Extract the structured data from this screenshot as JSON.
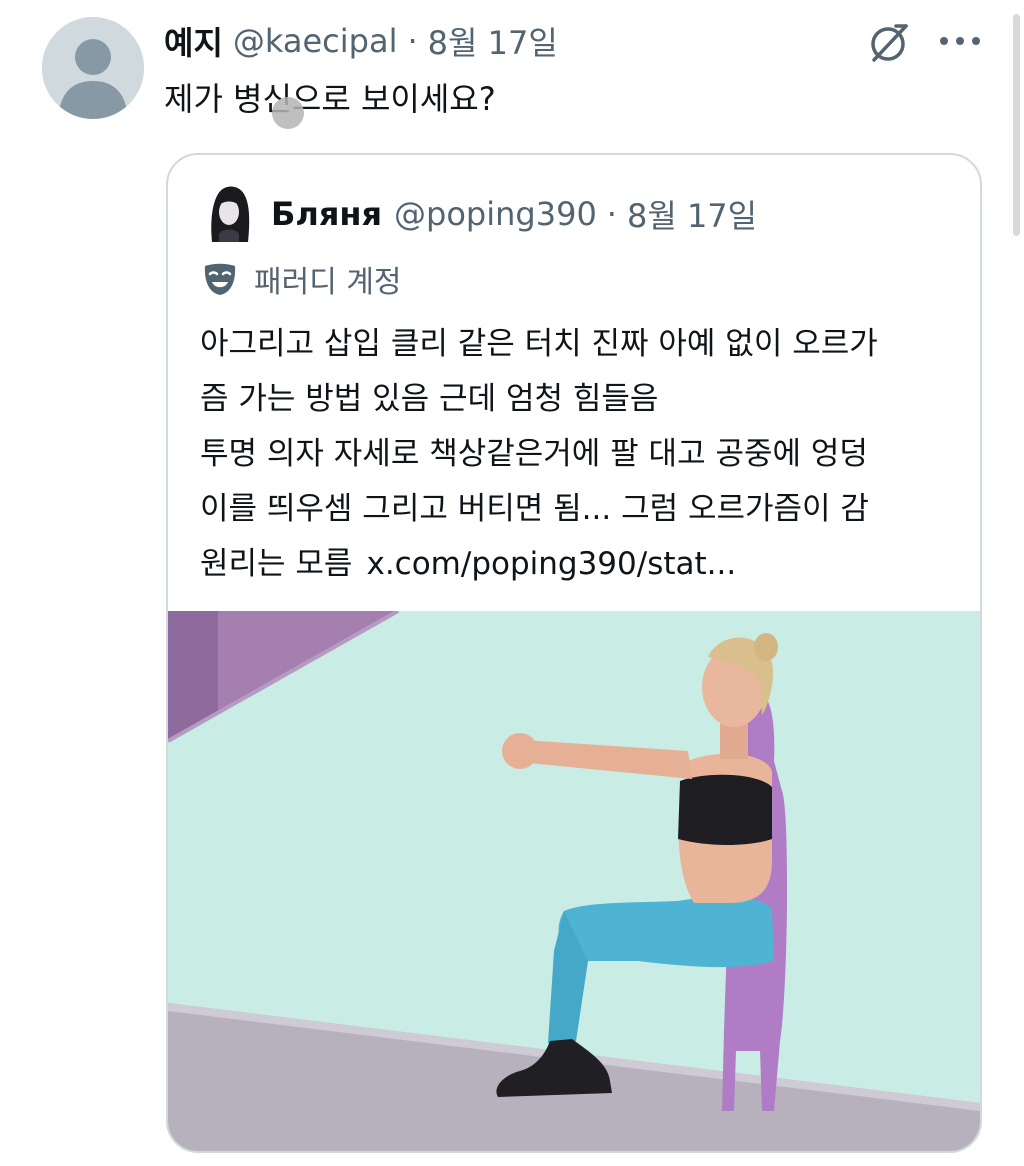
{
  "tweet": {
    "display_name": "예지",
    "handle": "@kaecipal",
    "separator": "·",
    "date": "8월 17일",
    "text": "제가 병신으로 보이세요?"
  },
  "icons": {
    "avatar": "default-avatar-icon",
    "grok": "grok-icon",
    "more": "more-icon",
    "parody": "parody-mask-icon"
  },
  "quoted_tweet": {
    "display_name": "Бляня",
    "handle": "@poping390",
    "separator": "·",
    "date": "8월 17일",
    "parody_label": "패러디 계정",
    "lines": [
      "아그리고 삽입 클리 같은 터치 진짜 아예 없이 오르가",
      "즘 가는 방법 있음 근데 엄청 힘들음",
      "투명 의자 자세로 책상같은거에 팔 대고 공중에 엉덩",
      "이를 띄우셈 그리고 버티면 됨... 그럼 오르가즘이 감",
      "원리는 모름"
    ],
    "link": "x.com/poping390/stat..."
  },
  "colors": {
    "text_primary": "#0f1419",
    "text_secondary": "#536471",
    "border": "#cfd9de",
    "photo_background": "#c8ebe4"
  }
}
